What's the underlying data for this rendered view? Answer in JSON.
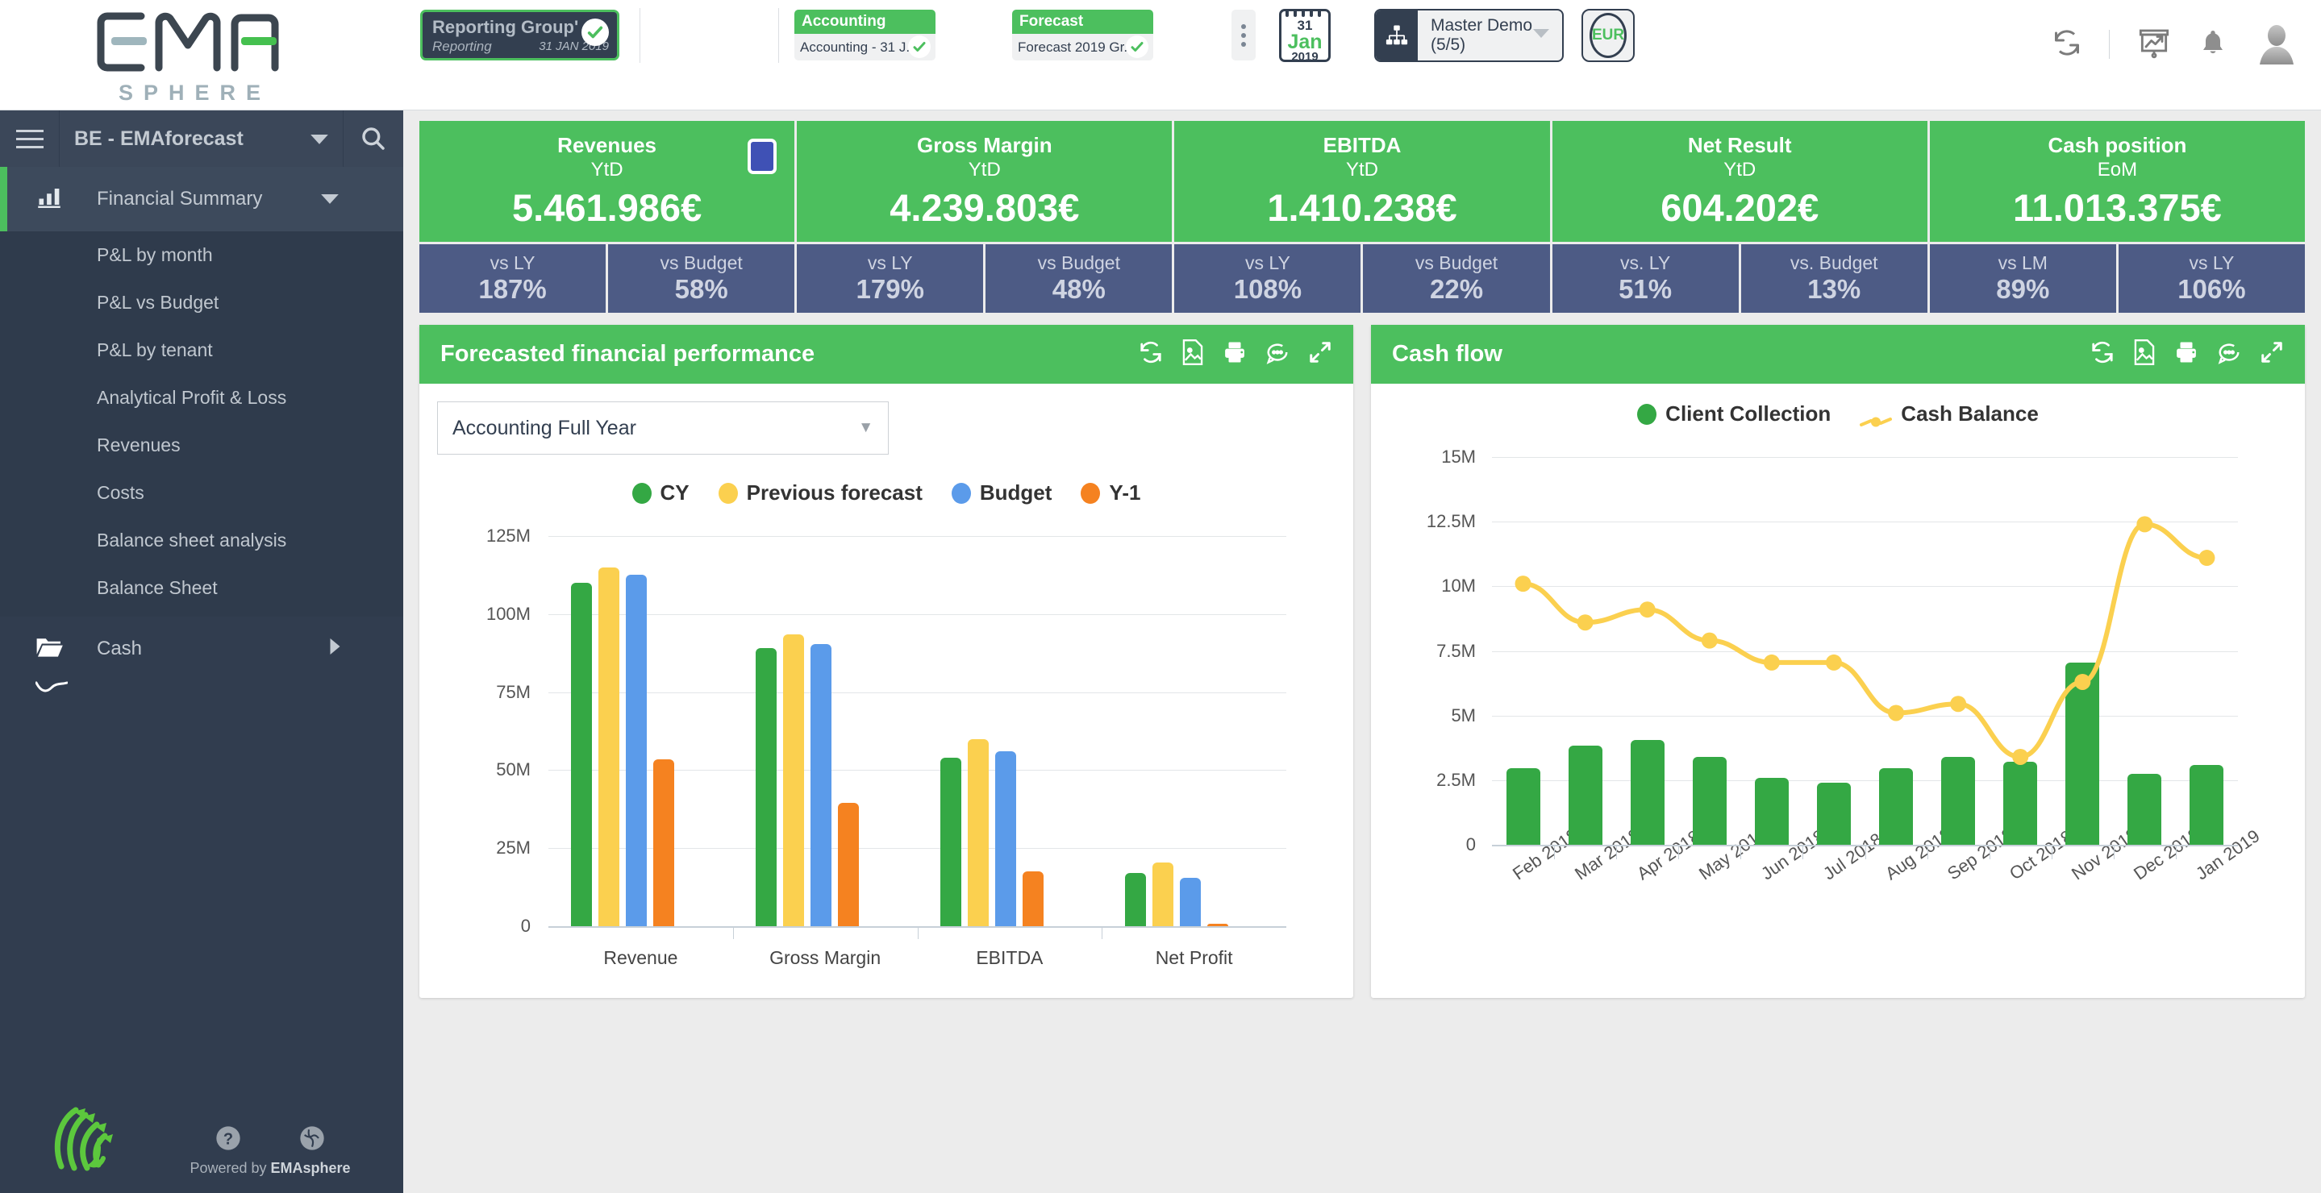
{
  "brand": {
    "name": "EMA",
    "subtitle": "SPHERE",
    "footer_text": "Powered by ",
    "footer_brand": "EMAsphere"
  },
  "topbar": {
    "reporting_group": {
      "title": "Reporting Group'",
      "subtitle": "Reporting",
      "date": "31 JAN 2019"
    },
    "selectors": [
      {
        "header": "Accounting",
        "value": "Accounting - 31 J..."
      },
      {
        "header": "Forecast",
        "value": "Forecast 2019 Gr..."
      }
    ],
    "calendar": {
      "day": "31",
      "month": "Jan",
      "year": "2019"
    },
    "entity": "Master Demo (5/5)",
    "currency": "EUR",
    "icons": [
      "refresh-icon",
      "presentation-icon",
      "bell-icon",
      "avatar-icon"
    ]
  },
  "sidebar": {
    "project": "BE - EMAforecast",
    "group": {
      "label": "Financial Summary"
    },
    "items": [
      {
        "label": "P&L by month"
      },
      {
        "label": "P&L vs Budget"
      },
      {
        "label": "P&L by tenant"
      },
      {
        "label": "Analytical Profit & Loss"
      },
      {
        "label": "Revenues"
      },
      {
        "label": "Costs"
      },
      {
        "label": "Balance sheet analysis"
      },
      {
        "label": "Balance Sheet"
      }
    ],
    "folder": {
      "label": "Cash"
    }
  },
  "kpis": [
    {
      "title": "Revenues",
      "period": "YtD",
      "value": "5.461.986€",
      "flag": true,
      "comparisons": [
        {
          "label": "vs LY",
          "value": "187%"
        },
        {
          "label": "vs Budget",
          "value": "58%"
        }
      ]
    },
    {
      "title": "Gross Margin",
      "period": "YtD",
      "value": "4.239.803€",
      "flag": false,
      "comparisons": [
        {
          "label": "vs LY",
          "value": "179%"
        },
        {
          "label": "vs Budget",
          "value": "48%"
        }
      ]
    },
    {
      "title": "EBITDA",
      "period": "YtD",
      "value": "1.410.238€",
      "flag": false,
      "comparisons": [
        {
          "label": "vs LY",
          "value": "108%"
        },
        {
          "label": "vs Budget",
          "value": "22%"
        }
      ]
    },
    {
      "title": "Net Result",
      "period": "YtD",
      "value": "604.202€",
      "flag": false,
      "comparisons": [
        {
          "label": "vs. LY",
          "value": "51%"
        },
        {
          "label": "vs. Budget",
          "value": "13%"
        }
      ]
    },
    {
      "title": "Cash position",
      "period": "EoM",
      "value": "11.013.375€",
      "flag": false,
      "comparisons": [
        {
          "label": "vs LM",
          "value": "89%"
        },
        {
          "label": "vs LY",
          "value": "106%"
        }
      ]
    }
  ],
  "panels": [
    {
      "title": "Forecasted financial performance",
      "dropdown": "Accounting Full Year",
      "tools": [
        "refresh-icon",
        "export-image-icon",
        "print-icon",
        "comment-icon",
        "expand-icon"
      ]
    },
    {
      "title": "Cash flow",
      "tools": [
        "refresh-icon",
        "export-image-icon",
        "print-icon",
        "comment-icon",
        "expand-icon"
      ]
    }
  ],
  "colors": {
    "green": "#4cbf5e",
    "series_cy": "#34a844",
    "series_prev": "#fbd04f",
    "series_budget": "#5b9bea",
    "series_ym1": "#f58220",
    "navy": "#313d4f",
    "compare_bg": "#4d5b85",
    "kpi_flag": "#3f51b5"
  },
  "chart_data": [
    {
      "type": "bar",
      "title": "Forecasted financial performance",
      "categories": [
        "Revenue",
        "Gross Margin",
        "EBITDA",
        "Net Profit"
      ],
      "series": [
        {
          "name": "CY",
          "color": "#34a844",
          "values": [
            110000000,
            89000000,
            54000000,
            17000000
          ]
        },
        {
          "name": "Previous forecast",
          "color": "#fbd04f",
          "values": [
            115000000,
            93500000,
            60000000,
            20500000
          ]
        },
        {
          "name": "Budget",
          "color": "#5b9bea",
          "values": [
            112500000,
            90500000,
            56000000,
            15500000
          ]
        },
        {
          "name": "Y-1",
          "color": "#f58220",
          "values": [
            53500000,
            39500000,
            17500000,
            900000
          ]
        }
      ],
      "xlabel": "",
      "ylabel": "",
      "ylim": [
        0,
        125000000
      ],
      "yticks": [
        0,
        25000000,
        50000000,
        75000000,
        100000000,
        125000000
      ],
      "ytick_labels": [
        "0",
        "25M",
        "50M",
        "75M",
        "100M",
        "125M"
      ],
      "grid": true,
      "legend_position": "top"
    },
    {
      "type": "line+bar",
      "title": "Cash flow",
      "categories": [
        "Feb 2018",
        "Mar 2018",
        "Apr 2018",
        "May 2018",
        "Jun 2018",
        "Jul 2018",
        "Aug 2018",
        "Sep 2018",
        "Oct 2018",
        "Nov 2018",
        "Dec 2018",
        "Jan 2019"
      ],
      "series": [
        {
          "name": "Client Collection",
          "type": "bar",
          "color": "#34a844",
          "values": [
            2950000,
            3850000,
            4050000,
            3400000,
            2600000,
            2400000,
            2950000,
            3400000,
            3200000,
            7050000,
            2750000,
            3100000
          ]
        },
        {
          "name": "Cash Balance",
          "type": "line",
          "color": "#fbd04f",
          "values": [
            10100000,
            8600000,
            9100000,
            7900000,
            7050000,
            7050000,
            5100000,
            5450000,
            3400000,
            6300000,
            12400000,
            11100000
          ]
        }
      ],
      "xlabel": "",
      "ylabel": "",
      "ylim": [
        0,
        15000000
      ],
      "yticks": [
        0,
        2500000,
        5000000,
        7500000,
        10000000,
        12500000,
        15000000
      ],
      "ytick_labels": [
        "0",
        "2.5M",
        "5M",
        "7.5M",
        "10M",
        "12.5M",
        "15M"
      ],
      "grid": true,
      "legend_position": "top"
    }
  ]
}
